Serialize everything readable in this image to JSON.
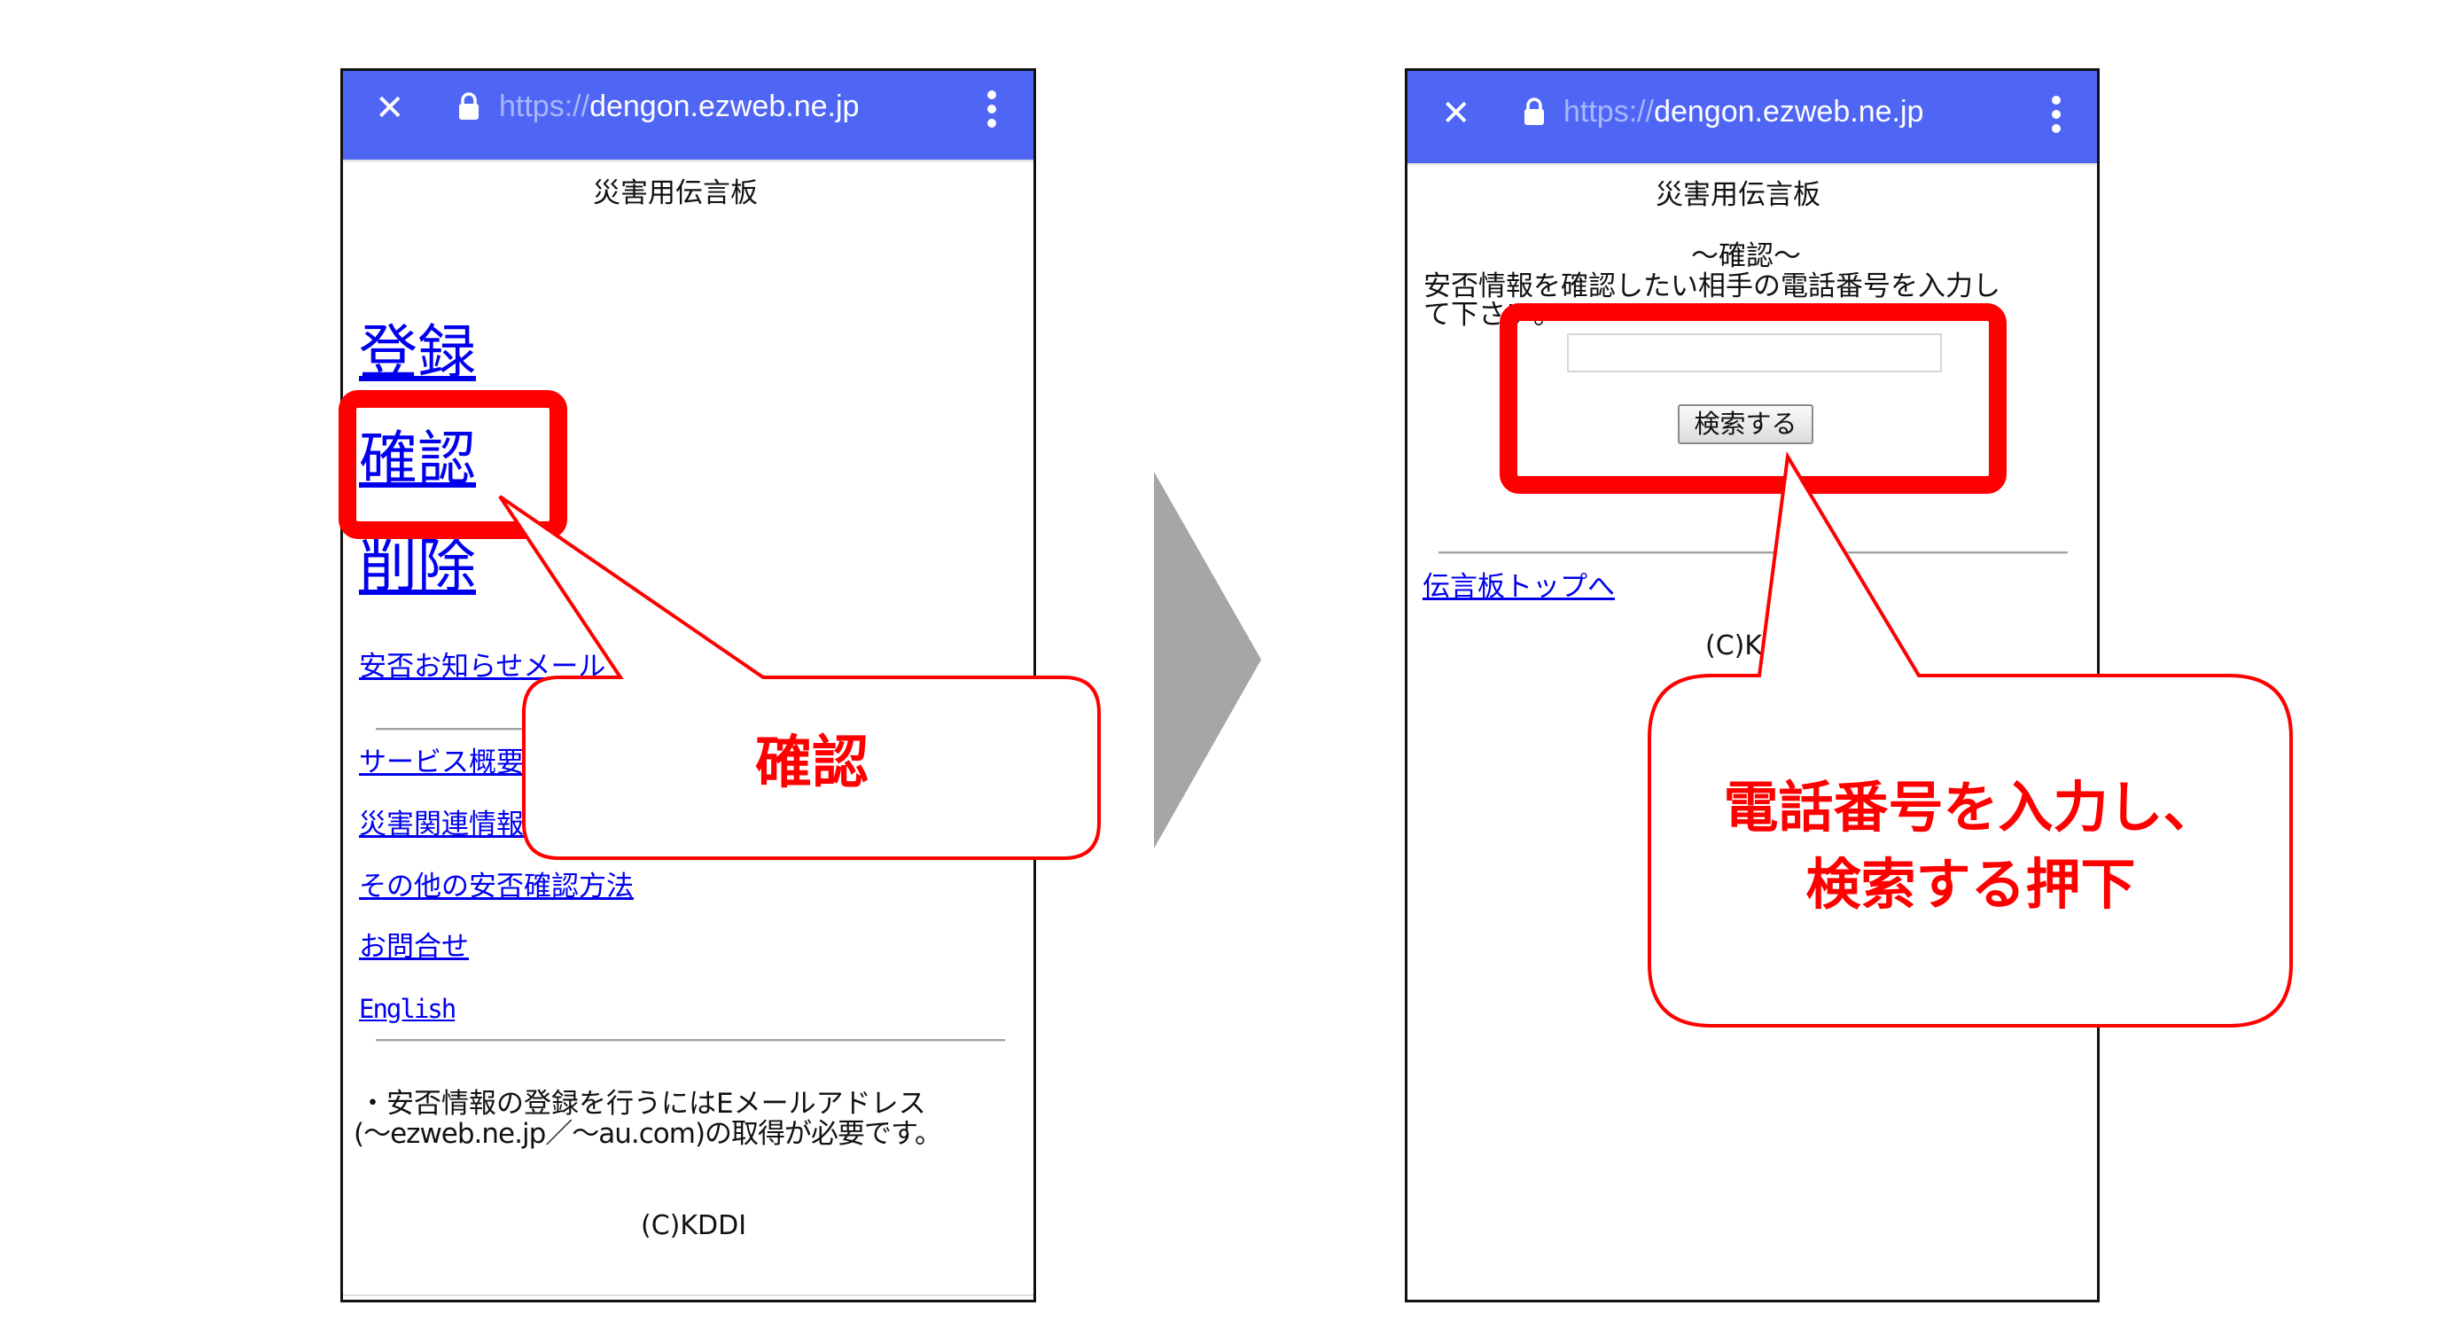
{
  "browser": {
    "url_scheme": "https://",
    "url_host": "dengon.ezweb.ne.jp",
    "close_icon": "close-icon",
    "lock_icon": "lock-icon",
    "menu_icon": "kebab-menu-icon",
    "bar_color": "#4f66f4"
  },
  "left_screen": {
    "title": "災害用伝言板",
    "big_links": [
      "登録",
      "確認",
      "削除"
    ],
    "links": [
      "安否お知らせメール",
      "サービス概要",
      "災害関連情報",
      "その他の安否確認方法",
      "お問合せ",
      "English"
    ],
    "notice_line1": "・安否情報の登録を行うにはEメールアドレス",
    "notice_line2": "(〜ezweb.ne.jp／〜au.com)の取得が必要です。",
    "copyright": "(C)KDDI"
  },
  "right_screen": {
    "title": "災害用伝言板",
    "section_heading": "〜確認〜",
    "instruction_line1": "安否情報を確認したい相手の電話番号を入力し",
    "instruction_line2": "て下さい。",
    "phone_input_value": "",
    "search_button": "検索する",
    "top_link": "伝言板トップへ",
    "copyright": "(C)KDDI"
  },
  "annotations": {
    "left_callout": "確認",
    "right_callout_line1": "電話番号を入力し、",
    "right_callout_line2": "検索する押下",
    "highlight_color": "#ff0000",
    "arrow_color": "#a6a6a6",
    "arrow_icon": "next-step-arrow-icon"
  }
}
